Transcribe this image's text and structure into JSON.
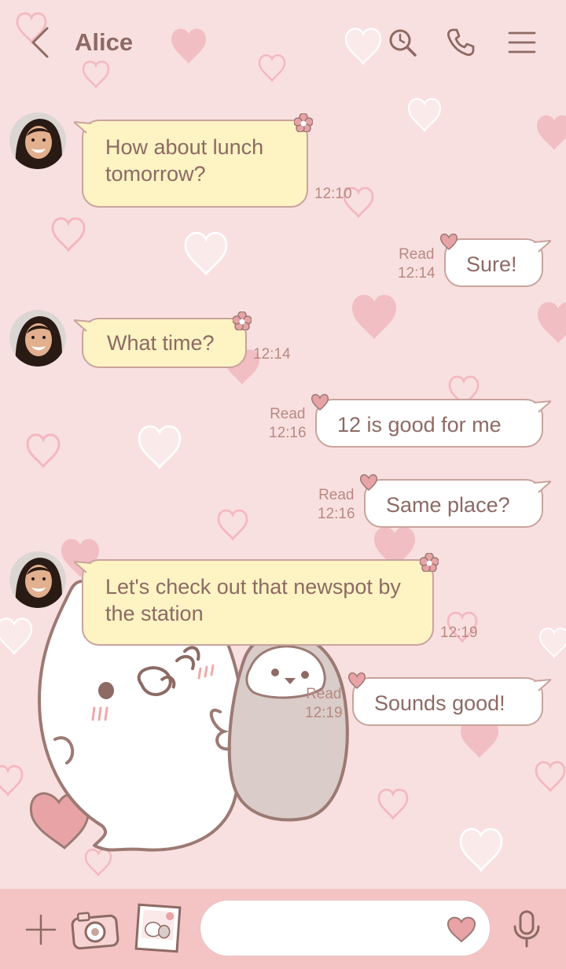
{
  "header": {
    "contact_name": "Alice",
    "back_icon": "chevron-left-icon",
    "search_icon": "search-icon",
    "call_icon": "phone-icon",
    "menu_icon": "menu-icon"
  },
  "messages": [
    {
      "direction": "incoming",
      "text": "How about lunch tomorrow?",
      "time": "12:10"
    },
    {
      "direction": "outgoing",
      "text": "Sure!",
      "read": "Read",
      "time": "12:14"
    },
    {
      "direction": "incoming",
      "text": "What time?",
      "time": "12:14"
    },
    {
      "direction": "outgoing",
      "text": "12 is good for me",
      "read": "Read",
      "time": "12:16"
    },
    {
      "direction": "outgoing",
      "text": "Same place?",
      "read": "Read",
      "time": "12:16"
    },
    {
      "direction": "incoming",
      "text": "Let's check out that newspot by the station",
      "time": "12:19"
    },
    {
      "direction": "outgoing",
      "text": "Sounds good!",
      "read": "Read",
      "time": "12:19"
    }
  ],
  "composer": {
    "placeholder": "",
    "icons": [
      "plus-icon",
      "camera-icon",
      "sticker-icon",
      "emoji-heart-icon",
      "microphone-icon"
    ]
  },
  "colors": {
    "background": "#f9e0e0",
    "accent": "#8d6a64",
    "incoming_bubble": "#fdf3c3",
    "outgoing_bubble": "#ffffff",
    "bottom_bar": "#f4c4c4"
  }
}
